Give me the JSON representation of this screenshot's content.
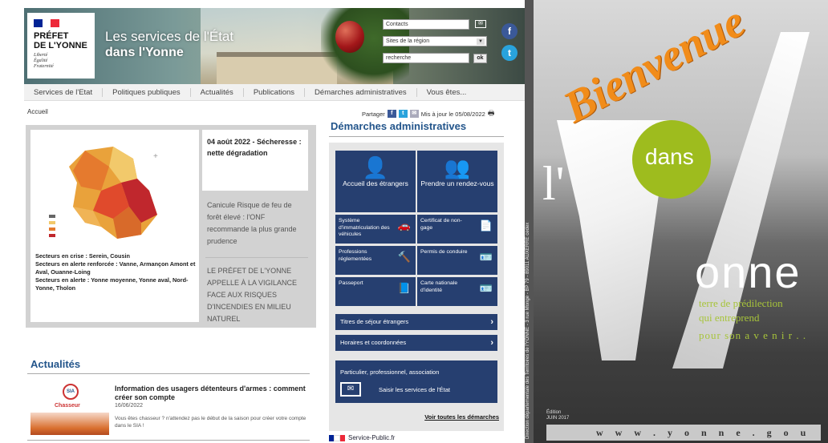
{
  "header": {
    "logo": {
      "line1": "PRÉFET",
      "line2": "DE L'YONNE",
      "motto": [
        "Liberté",
        "Égalité",
        "Fraternité"
      ]
    },
    "title_line1": "Les services de l'État",
    "title_line2": "dans l'Yonne",
    "contacts": "Contacts",
    "region_select": "Sites de la région",
    "search_placeholder": "recherche",
    "ok": "ok",
    "facebook": "f",
    "twitter": "t"
  },
  "nav": [
    "Services de l'Etat",
    "Politiques publiques",
    "Actualités",
    "Publications",
    "Démarches administratives",
    "Vous êtes..."
  ],
  "breadcrumb": "Accueil",
  "share": {
    "label": "Partager",
    "updated": "Mis à jour le 05/08/2022"
  },
  "une": {
    "news_title": "04 août 2022 - Sécheresse : nette dégradation",
    "crisis": "Secteurs en crise : Serein, Cousin",
    "alert_reinforced": "Secteurs en alerte renforcée : Vanne, Armançon Amont et Aval, Ouanne-Loing",
    "alert": "Secteurs en alerte : Yonne moyenne, Yonne aval, Nord-Yonne, Tholon",
    "item2": "Canicule Risque de feu de forêt élevé : l'ONF recommande la plus grande prudence",
    "item3": "LE PRÉFET DE L'YONNE APPELLE À LA VIGILANCE FACE AUX RISQUES D'INCENDIES EN MILIEU NATUREL"
  },
  "actualites": {
    "title": "Actualités",
    "item": {
      "headline": "Information des usagers détenteurs d'armes : comment créer son compte",
      "date": "16/06/2022",
      "desc": "Vous êtes chasseur ? n'attendez pas le début de la saison pour créer votre compte dans le SIA !",
      "badge": "SIA",
      "badge_caption": "Chasseur"
    }
  },
  "demarches": {
    "title": "Démarches administratives",
    "big_tiles": [
      "Accueil des étrangers",
      "Prendre un rendez-vous"
    ],
    "small_tiles": [
      "Système d'immatriculation des véhicules",
      "Certificat de non-gage",
      "Professions réglementées",
      "Permis de conduire",
      "Passeport",
      "Carte nationale d'identité"
    ],
    "bars": [
      "Titres de séjour étrangers",
      "Horaires et coordonnées"
    ],
    "portal_line1": "Particulier, professionnel, association",
    "portal_line2": "Saisir les services de l'État",
    "see_all": "Voir toutes les démarches",
    "service_public": "Service-Public.fr"
  },
  "poster": {
    "bienvenue": "Bienvenue",
    "l_apostrophe": "l'",
    "dans": "dans",
    "onne": "onne",
    "tagline1": "terre de prédilection",
    "tagline2": "qui entreprend",
    "tagline3": "pour son a v e n i r . .",
    "edition_line1": "Édition",
    "edition_line2": "JUIN 2017",
    "url": "w w w . y o n n e . g o u v . f r",
    "vertical_text": "Direction départementale des Territoires de l'YONNE - 3 rue Monge - BP 79 - 89011 AUXERRE cedex"
  },
  "colors": {
    "navy": "#263f70",
    "title_blue": "#23558b",
    "orange": "#f18c1a",
    "green": "#9ebc1e",
    "flag_blue": "#002395",
    "flag_red": "#ed2939"
  }
}
